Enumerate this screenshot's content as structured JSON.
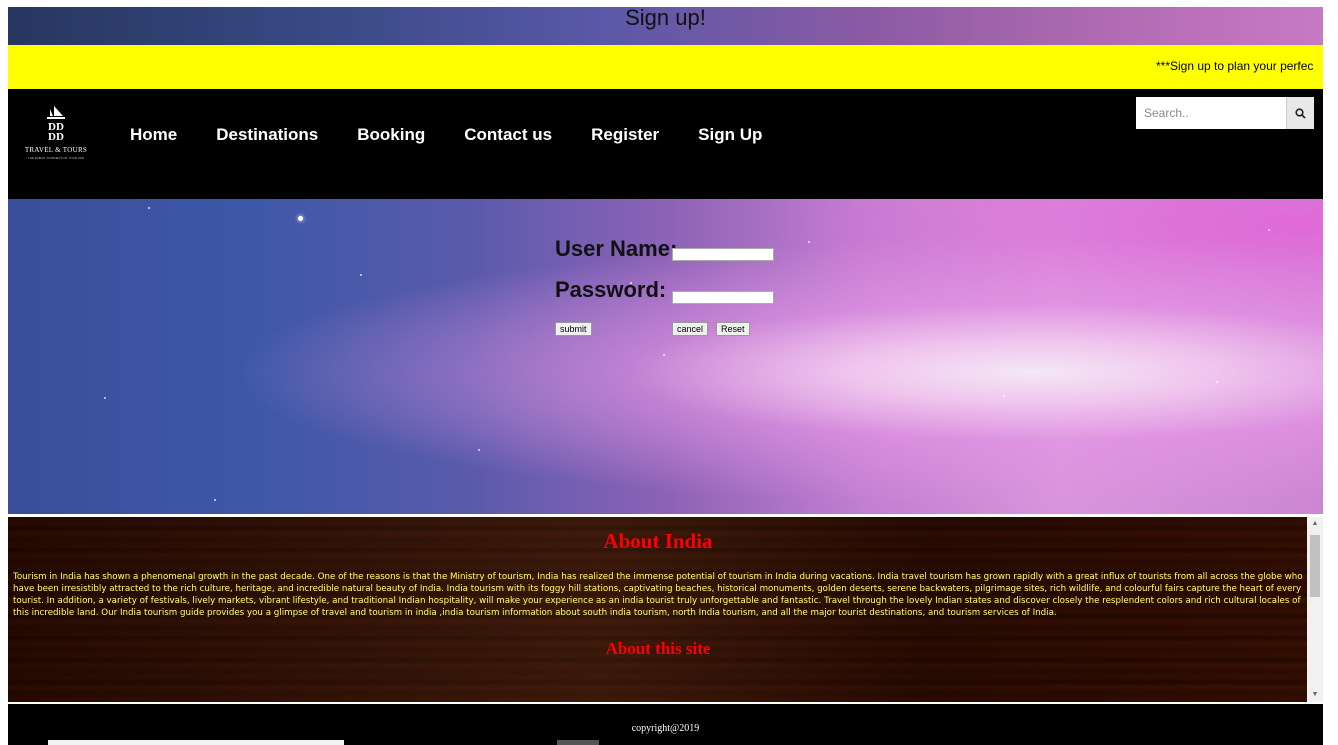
{
  "header": {
    "title": "Sign up!"
  },
  "marquee": {
    "text": "***Sign up to plan your perfec"
  },
  "navbar": {
    "logo": {
      "brand_text": "TRAVEL & TOURS",
      "tagline": "THE FINEST JOURNEYS OF YOUR LIFE"
    },
    "links": [
      {
        "label": "Home"
      },
      {
        "label": "Destinations"
      },
      {
        "label": "Booking"
      },
      {
        "label": "Contact us"
      },
      {
        "label": "Register"
      },
      {
        "label": "Sign Up"
      }
    ],
    "search": {
      "placeholder": "Search.."
    }
  },
  "login_form": {
    "username_label": "User Name:",
    "password_label": "Password:",
    "username_value": "",
    "password_value": "",
    "submit_label": "submit",
    "cancel_label": "cancel",
    "reset_label": "Reset"
  },
  "about": {
    "title": "About India",
    "text": "Tourism in India has shown a phenomenal growth in the past decade. One of the reasons is that the Ministry of tourism, India has realized the immense potential of tourism in India during vacations. India travel tourism has grown rapidly with a great influx of tourists from all across the globe who have been irresistibly attracted to the rich culture, heritage, and incredible natural beauty of India. India tourism with its foggy hill stations, captivating beaches, historical monuments, golden deserts, serene backwaters, pilgrimage sites, rich wildlife, and colourful fairs capture the heart of every tourist. In addition, a variety of festivals, lively markets, vibrant lifestyle, and traditional Indian hospitality, will make your experience as an india tourist truly unforgettable and fantastic. Travel through the lovely Indian states and discover closely the resplendent colors and rich cultural locales of this incredible land. Our India tourism guide provides you a glimpse of travel and tourism in india ,india tourism information about south india tourism, north India tourism, and all the major tourist destinations, and tourism services of India.",
    "site_title": "About this site"
  },
  "footer": {
    "copyright": "copyright@2019"
  },
  "colors": {
    "marquee_bg": "#ffff00",
    "navbar_bg": "#000000",
    "about_title": "#ff0000",
    "about_text": "#ffff66"
  },
  "icons": {
    "search": "search-icon",
    "logo": "ship-logo-icon"
  }
}
